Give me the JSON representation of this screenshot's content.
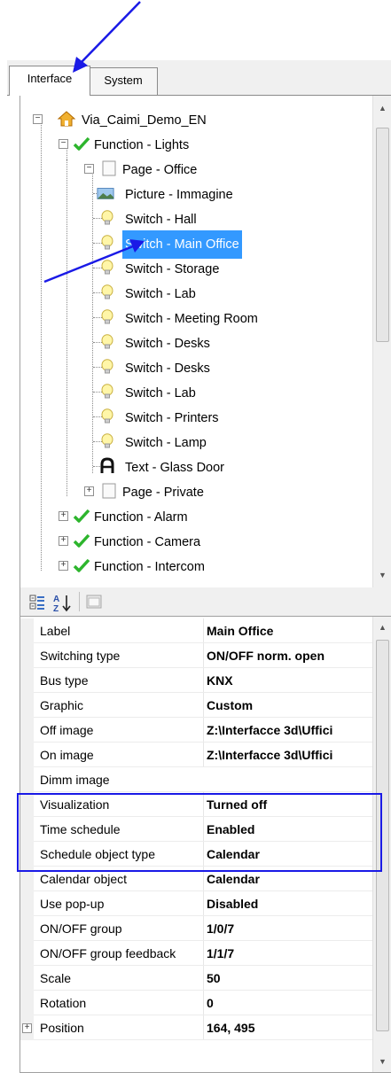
{
  "tabs": [
    {
      "label": "Interface",
      "active": true
    },
    {
      "label": "System",
      "active": false
    }
  ],
  "tree": {
    "root": "Via_Caimi_Demo_EN",
    "functions": [
      {
        "label": "Function - Lights",
        "expanded": true
      },
      {
        "label": "Function - Alarm",
        "expanded": false
      },
      {
        "label": "Function - Camera",
        "expanded": false
      },
      {
        "label": "Function - Intercom",
        "expanded": false
      }
    ],
    "pages": [
      {
        "label": "Page - Office",
        "expanded": true
      },
      {
        "label": "Page - Private",
        "expanded": false
      }
    ],
    "items": [
      {
        "label": "Picture - Immagine",
        "icon": "picture-icon"
      },
      {
        "label": "Switch - Hall",
        "icon": "lightbulb-icon"
      },
      {
        "label": "Switch - Main Office",
        "icon": "lightbulb-icon",
        "selected": true
      },
      {
        "label": "Switch - Storage",
        "icon": "lightbulb-icon"
      },
      {
        "label": "Switch - Lab",
        "icon": "lightbulb-icon"
      },
      {
        "label": "Switch - Meeting Room",
        "icon": "lightbulb-icon"
      },
      {
        "label": "Switch - Desks",
        "icon": "lightbulb-icon"
      },
      {
        "label": "Switch - Desks",
        "icon": "lightbulb-icon"
      },
      {
        "label": "Switch - Lab",
        "icon": "lightbulb-icon"
      },
      {
        "label": "Switch - Printers",
        "icon": "lightbulb-icon"
      },
      {
        "label": "Switch - Lamp",
        "icon": "lightbulb-icon"
      },
      {
        "label": "Text - Glass Door",
        "icon": "text-icon"
      }
    ]
  },
  "toolbar": {
    "icons": [
      "categorized-icon",
      "sort-alphabetical-icon",
      "property-pages-icon"
    ]
  },
  "properties": [
    {
      "name": "Label",
      "value": "Main Office"
    },
    {
      "name": "Switching type",
      "value": "ON/OFF norm. open"
    },
    {
      "name": "Bus type",
      "value": "KNX"
    },
    {
      "name": "Graphic",
      "value": "Custom"
    },
    {
      "name": "Off image",
      "value": "Z:\\Interfacce 3d\\Uffici"
    },
    {
      "name": "On image",
      "value": "Z:\\Interfacce 3d\\Uffici"
    },
    {
      "name": "Dimm image",
      "value": ""
    },
    {
      "name": "Visualization",
      "value": "Turned off"
    },
    {
      "name": "Time schedule",
      "value": "Enabled"
    },
    {
      "name": "Schedule object type",
      "value": "Calendar"
    },
    {
      "name": "Calendar object",
      "value": "Calendar"
    },
    {
      "name": "Use pop-up",
      "value": "Disabled"
    },
    {
      "name": "ON/OFF group",
      "value": "1/0/7"
    },
    {
      "name": "ON/OFF group feedback",
      "value": "1/1/7"
    },
    {
      "name": "Scale",
      "value": "50"
    },
    {
      "name": "Rotation",
      "value": "0"
    },
    {
      "name": "Position",
      "value": "164, 495"
    }
  ],
  "colors": {
    "selection": "#3399ff",
    "annotation": "#1a1ae6",
    "check": "#2db52d"
  }
}
